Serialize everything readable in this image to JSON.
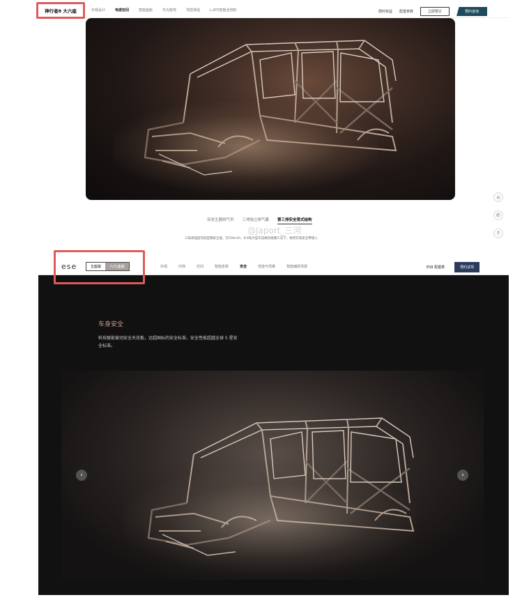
{
  "top_page": {
    "brand": "神行者8 大六座",
    "nav_links": [
      "外观设计",
      "电感空间",
      "智能座舱",
      "华为智驾",
      "驾控体验",
      "L-ATS智能全地形"
    ],
    "active_nav_index": 1,
    "nav_right": {
      "link1": "限时权益",
      "link2": "配置参数",
      "btn_order": "立即预订",
      "btn_consult": "预约咨询"
    },
    "tabs": [
      "双发生器侧气帘",
      "三排独立侧气囊",
      "第三排安全笼式结构"
    ],
    "active_tab_index": 2,
    "description": "三排高强度热成型钢安全笼，在50km/h、8.6吨大型车追尾的碰撞工况下，依然实现安全零侵入",
    "watermark": "@Japort_三河",
    "side_icons": [
      "car-icon",
      "phone-icon",
      "up-arrow-icon"
    ]
  },
  "bottom_page": {
    "logo": "ese",
    "variant_options": [
      "五座版",
      "六/七座版"
    ],
    "active_variant_index": 0,
    "nav_links": [
      "外观",
      "内饰",
      "空间",
      "智能系统",
      "安全",
      "性能与驾乘",
      "智能辅助驾驶"
    ],
    "active_nav_index": 4,
    "nav_right": {
      "config": "ES8 配置表",
      "btn_test_drive": "预约试驾"
    },
    "section_title": "车身安全",
    "section_description": "科技赋能被动安全天花板，远超国标的安全标准，安全性能超越全球 5 星安全标准。",
    "prev_label": "‹",
    "next_label": "›"
  },
  "colors": {
    "highlight_border": "#e05a5a",
    "consult_button": "#1e4a5e",
    "test_drive_button": "#2c3a5c",
    "section_title": "#c99b8a",
    "dark_background": "#121112"
  }
}
